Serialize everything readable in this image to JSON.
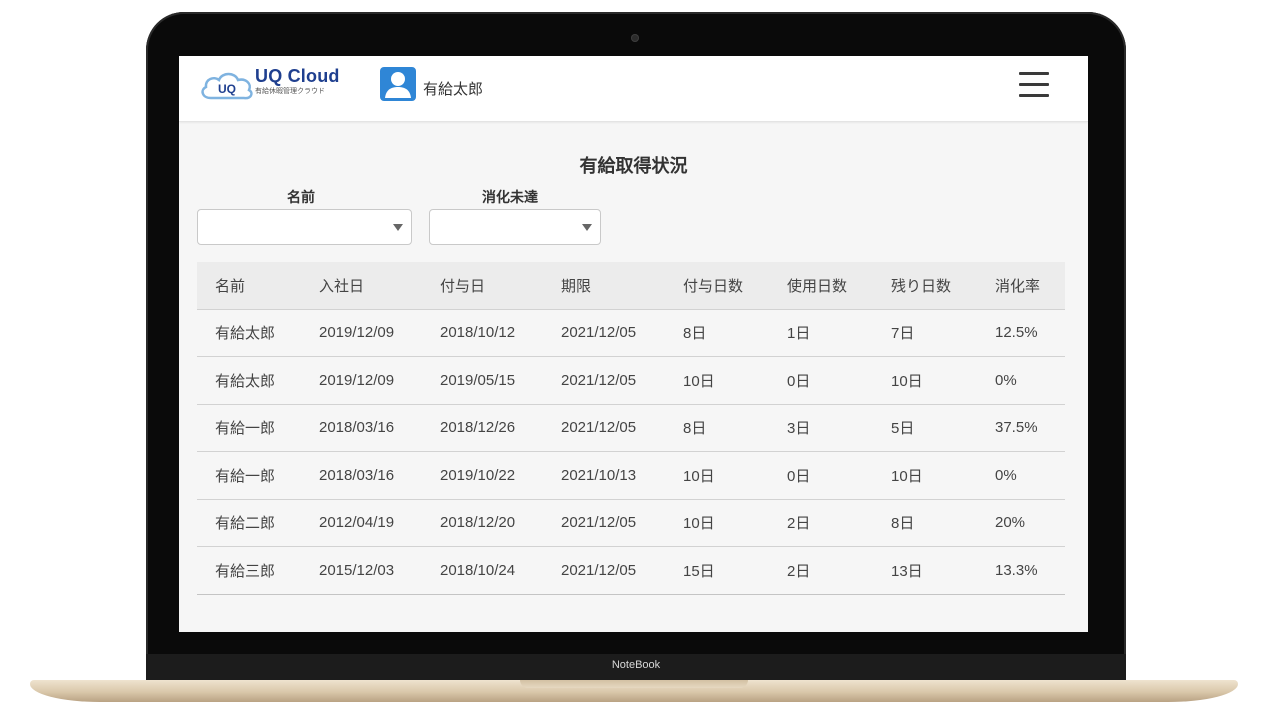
{
  "device": {
    "brand": "NoteBook"
  },
  "header": {
    "logo_title": "UQ Cloud",
    "logo_badge": "UQ",
    "logo_subtitle": "有給休暇管理クラウド",
    "user_name": "有給太郎",
    "menu_icon": "hamburger-menu-icon"
  },
  "page": {
    "title": "有給取得状況",
    "filters": [
      {
        "label": "名前",
        "value": ""
      },
      {
        "label": "消化未達",
        "value": ""
      }
    ]
  },
  "table": {
    "columns": [
      "名前",
      "入社日",
      "付与日",
      "期限",
      "付与日数",
      "使用日数",
      "残り日数",
      "消化率"
    ],
    "rows": [
      [
        "有給太郎",
        "2019/12/09",
        "2018/10/12",
        "2021/12/05",
        "8日",
        "1日",
        "7日",
        "12.5%"
      ],
      [
        "有給太郎",
        "2019/12/09",
        "2019/05/15",
        "2021/12/05",
        "10日",
        "0日",
        "10日",
        "0%"
      ],
      [
        "有給一郎",
        "2018/03/16",
        "2018/12/26",
        "2021/12/05",
        "8日",
        "3日",
        "5日",
        "37.5%"
      ],
      [
        "有給一郎",
        "2018/03/16",
        "2019/10/22",
        "2021/10/13",
        "10日",
        "0日",
        "10日",
        "0%"
      ],
      [
        "有給二郎",
        "2012/04/19",
        "2018/12/20",
        "2021/12/05",
        "10日",
        "2日",
        "8日",
        "20%"
      ],
      [
        "有給三郎",
        "2015/12/03",
        "2018/10/24",
        "2021/12/05",
        "15日",
        "2日",
        "13日",
        "13.3%"
      ]
    ]
  },
  "colors": {
    "brand": "#1f3f8f",
    "avatar": "#2f86d6",
    "header_row": "#ececec"
  }
}
